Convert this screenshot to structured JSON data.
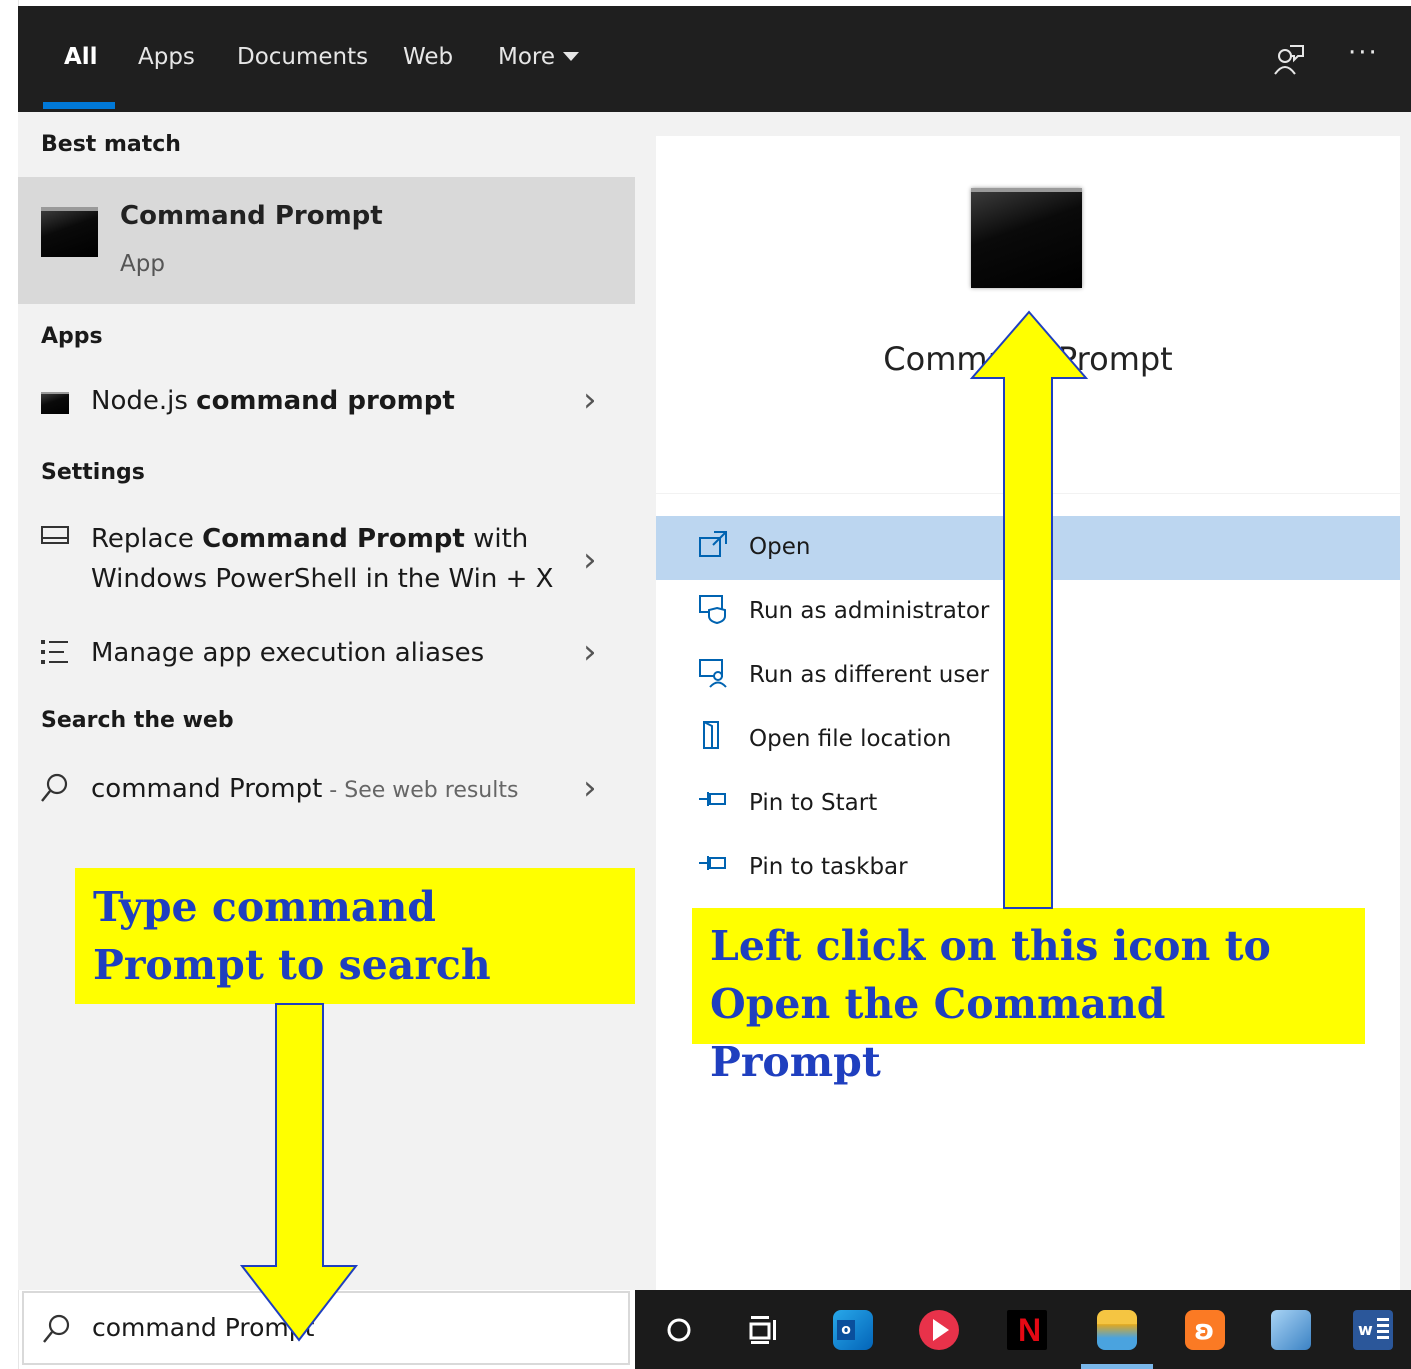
{
  "tabs": [
    {
      "label": "All"
    },
    {
      "label": "Apps"
    },
    {
      "label": "Documents"
    },
    {
      "label": "Web"
    },
    {
      "label": "More"
    }
  ],
  "sections": {
    "best_match": "Best match",
    "apps": "Apps",
    "settings": "Settings",
    "search_web": "Search the web"
  },
  "best_match": {
    "title": "Command Prompt",
    "subtitle": "App"
  },
  "apps_results": [
    {
      "prefix": "Node.js ",
      "bold": "command prompt"
    }
  ],
  "settings_results": [
    {
      "line1_prefix": "Replace ",
      "line1_bold": "Command Prompt",
      "line1_suffix": " with",
      "line2": "Windows PowerShell in the Win + X"
    },
    {
      "label": "Manage app execution aliases"
    }
  ],
  "web_result": {
    "query": "command Prompt",
    "suffix": " - See web results"
  },
  "preview": {
    "title": "Command Prompt"
  },
  "actions": [
    {
      "label": "Open",
      "icon": "open-icon"
    },
    {
      "label": "Run as administrator",
      "icon": "shield-icon"
    },
    {
      "label": "Run as different user",
      "icon": "user-icon"
    },
    {
      "label": "Open file location",
      "icon": "folder-icon"
    },
    {
      "label": "Pin to Start",
      "icon": "pin-icon"
    },
    {
      "label": "Pin to taskbar",
      "icon": "pin-icon"
    }
  ],
  "search": {
    "value": "command Prompt"
  },
  "annotations": {
    "left": "Type command Prompt to search",
    "right": "Left click on this icon to Open the Command Prompt"
  },
  "colors": {
    "accent": "#0078d7",
    "highlight": "#bcd6f0",
    "annotation_bg": "#ffff00",
    "annotation_text": "#1f3fbf"
  }
}
